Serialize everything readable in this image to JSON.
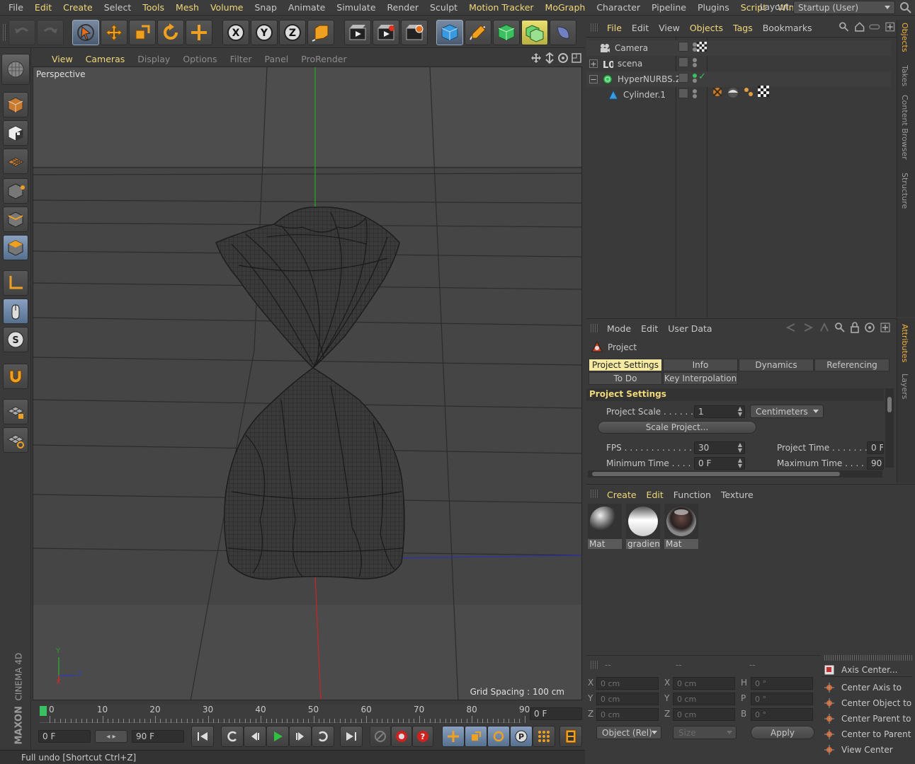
{
  "menubar": {
    "items": [
      {
        "label": "File",
        "hl": false
      },
      {
        "label": "Edit",
        "hl": true
      },
      {
        "label": "Create",
        "hl": true
      },
      {
        "label": "Select",
        "hl": false
      },
      {
        "label": "Tools",
        "hl": true
      },
      {
        "label": "Mesh",
        "hl": true
      },
      {
        "label": "Volume",
        "hl": true
      },
      {
        "label": "Snap",
        "hl": false
      },
      {
        "label": "Animate",
        "hl": false
      },
      {
        "label": "Simulate",
        "hl": false
      },
      {
        "label": "Render",
        "hl": false
      },
      {
        "label": "Sculpt",
        "hl": false
      },
      {
        "label": "Motion Tracker",
        "hl": true
      },
      {
        "label": "MoGraph",
        "hl": true
      },
      {
        "label": "Character",
        "hl": false
      },
      {
        "label": "Pipeline",
        "hl": false
      },
      {
        "label": "Plugins",
        "hl": false
      },
      {
        "label": "Script",
        "hl": true
      },
      {
        "label": "Winc",
        "hl": true
      }
    ],
    "layout_label": "Layout:",
    "layout_value": "Startup (User)"
  },
  "viewport": {
    "menu": [
      {
        "label": "View",
        "hl": true
      },
      {
        "label": "Cameras",
        "hl": true
      },
      {
        "label": "Display",
        "hl": false
      },
      {
        "label": "Options",
        "hl": false
      },
      {
        "label": "Filter",
        "hl": false
      },
      {
        "label": "Panel",
        "hl": false
      },
      {
        "label": "ProRender",
        "hl": false
      }
    ],
    "name": "Perspective",
    "grid_spacing": "Grid Spacing : 100 cm",
    "axis_y": "Y",
    "axis_z": "Z",
    "axis_x": "X"
  },
  "timeline": {
    "ticks": [
      "0",
      "10",
      "20",
      "30",
      "40",
      "50",
      "60",
      "70",
      "80",
      "90"
    ],
    "current_frame": "0 F",
    "start_frame": "0 F",
    "end_frame": "90 F"
  },
  "status": "Full undo [Shortcut Ctrl+Z]",
  "brand": {
    "maxon": "MAXON",
    "cinema": "CINEMA 4D"
  },
  "objects_panel": {
    "menu": [
      {
        "label": "File",
        "hl": true
      },
      {
        "label": "Edit",
        "hl": false
      },
      {
        "label": "View",
        "hl": false
      },
      {
        "label": "Objects",
        "hl": true
      },
      {
        "label": "Tags",
        "hl": true
      },
      {
        "label": "Bookmarks",
        "hl": false
      }
    ],
    "rows": [
      {
        "name": "Camera",
        "indent": 0,
        "expander": ""
      },
      {
        "name": "scena",
        "indent": 0,
        "expander": "+"
      },
      {
        "name": "HyperNURBS.2",
        "indent": 0,
        "expander": "−"
      },
      {
        "name": "Cylinder.1",
        "indent": 1,
        "expander": ""
      }
    ]
  },
  "side_tabs_top": [
    "Objects",
    "Takes",
    "Content Browser",
    "Structure"
  ],
  "side_tabs_mid": [
    "Attributes",
    "Layers"
  ],
  "attributes": {
    "menu": [
      {
        "label": "Mode"
      },
      {
        "label": "Edit"
      },
      {
        "label": "User Data"
      }
    ],
    "title": "Project",
    "tabs_row1": [
      "Project Settings",
      "Info",
      "Dynamics",
      "Referencing"
    ],
    "tabs_row2": [
      "To Do",
      "Key Interpolation"
    ],
    "section": "Project Settings",
    "project_scale_label": "Project Scale . . . . . . .",
    "project_scale_value": "1",
    "unit_value": "Centimeters",
    "scale_button": "Scale Project...",
    "fps_label": "FPS . . . . . . . . . . . . . . .",
    "fps_value": "30",
    "project_time_label": "Project Time . . . . . . . .",
    "project_time_value": "0 F",
    "min_time_label": "Minimum Time . . . . .",
    "min_time_value": "0 F",
    "max_time_label": "Maximum Time . . . . . .",
    "max_time_value": "90"
  },
  "materials": {
    "menu": [
      {
        "label": "Create",
        "hl": true
      },
      {
        "label": "Edit",
        "hl": true
      },
      {
        "label": "Function",
        "hl": false
      },
      {
        "label": "Texture",
        "hl": false
      }
    ],
    "items": [
      "Mat",
      "gradien",
      "Mat"
    ]
  },
  "coordinates": {
    "header": [
      "--",
      "--",
      "--"
    ],
    "rows": [
      {
        "a": "X",
        "av": "0 cm",
        "b": "X",
        "bv": "0 cm",
        "c": "H",
        "cv": "0 °"
      },
      {
        "a": "Y",
        "av": "0 cm",
        "b": "Y",
        "bv": "0 cm",
        "c": "P",
        "cv": "0 °"
      },
      {
        "a": "Z",
        "av": "0 cm",
        "b": "Z",
        "bv": "0 cm",
        "c": "B",
        "cv": "0 °"
      }
    ],
    "mode": "Object (Rel)",
    "size": "Size",
    "apply": "Apply"
  },
  "axis_center": {
    "items": [
      "Axis Center...",
      "Center Axis to",
      "Center Object to",
      "Center Parent to",
      "Center to Parent",
      "View Center"
    ]
  }
}
